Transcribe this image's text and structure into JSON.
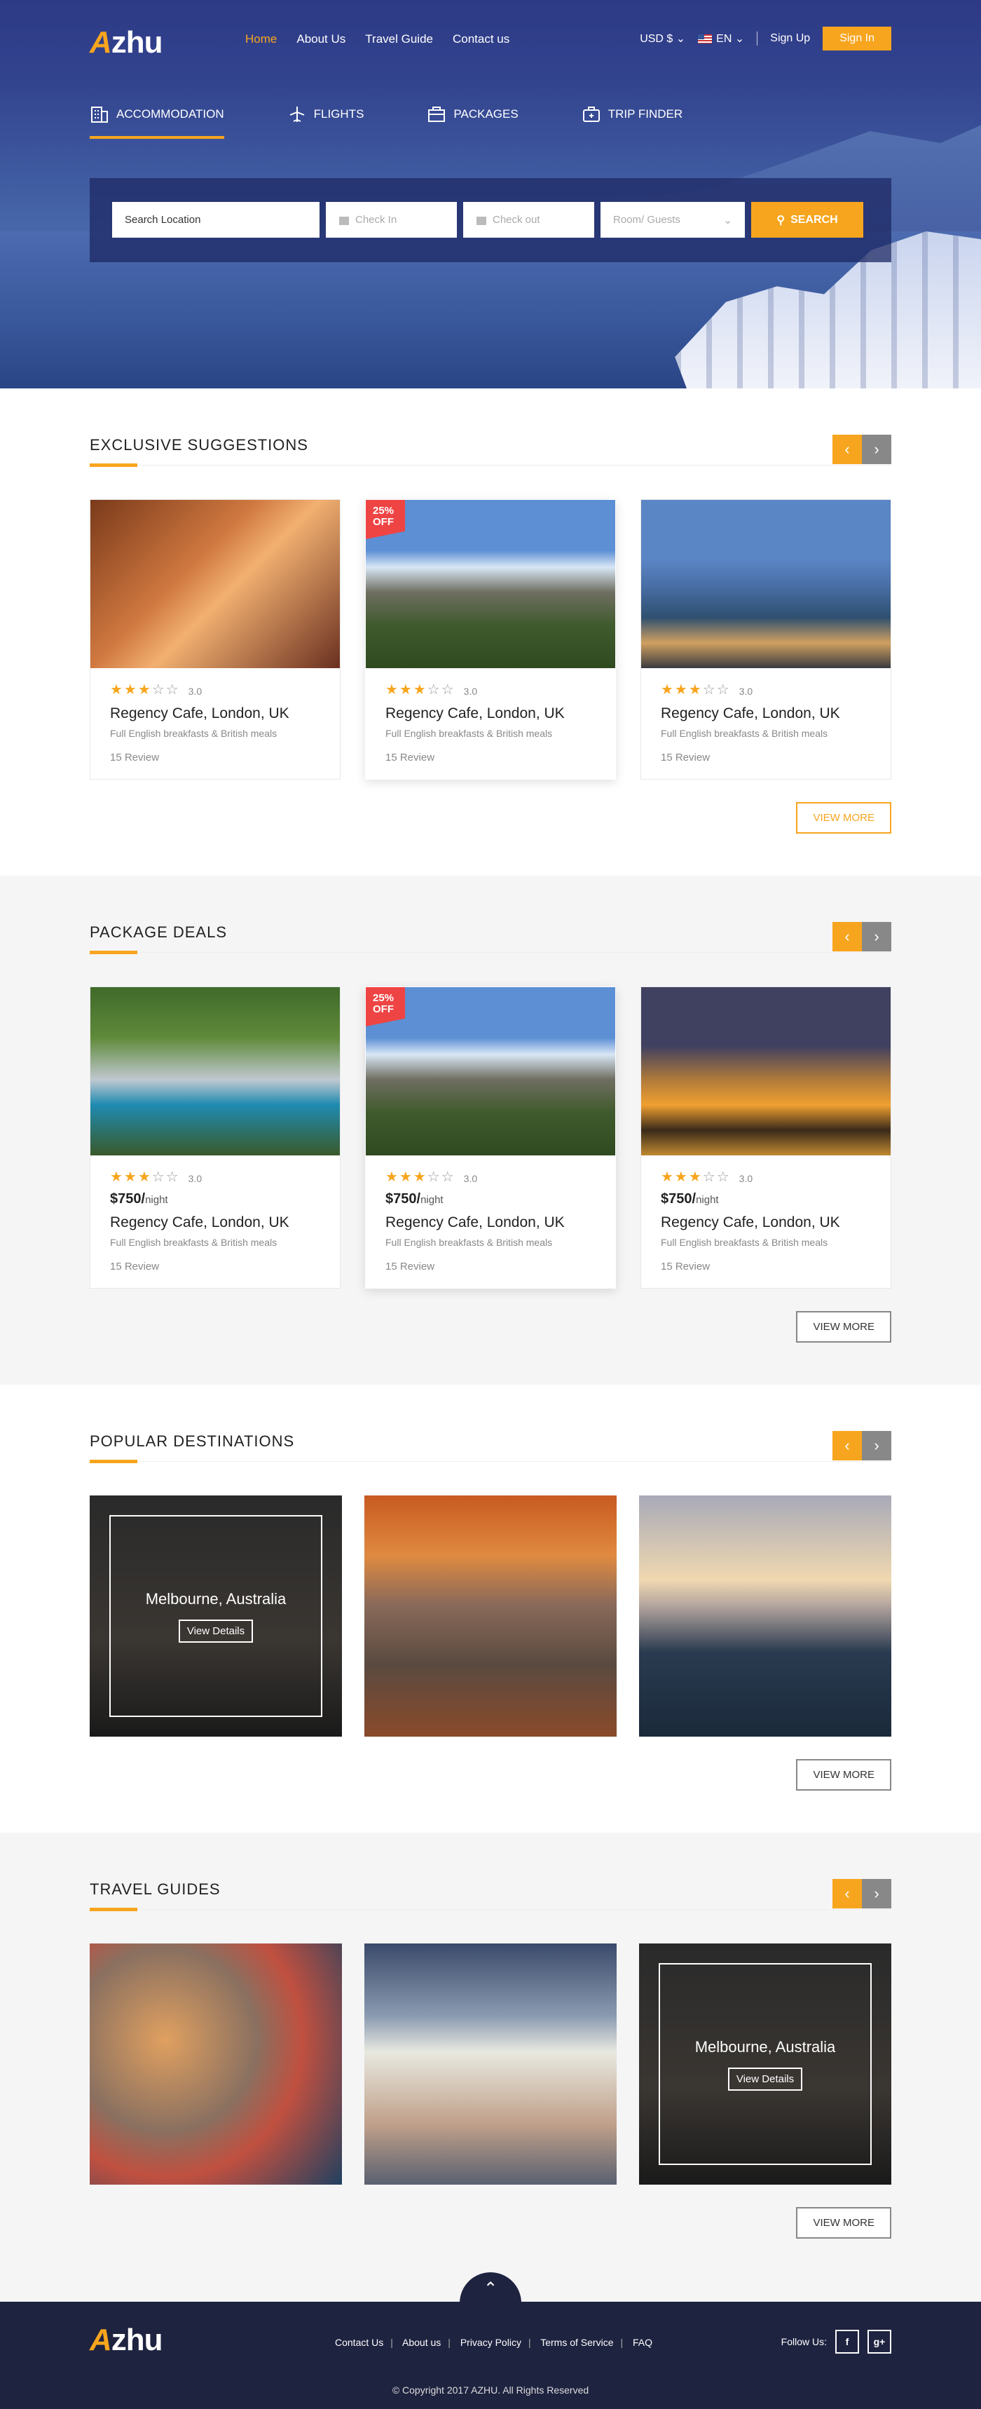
{
  "brand": {
    "logo_a": "A",
    "logo_rest": "zhu"
  },
  "nav": {
    "items": [
      "Home",
      "About Us",
      "Travel Guide",
      "Contact us"
    ],
    "currency": "USD $",
    "language": "EN",
    "signup": "Sign Up",
    "signin": "Sign In"
  },
  "tabs": [
    "ACCOMMODATION",
    "FLIGHTS",
    "PACKAGES",
    "TRIP FINDER"
  ],
  "search": {
    "location_placeholder": "Search Location",
    "checkin": "Check In",
    "checkout": "Check out",
    "guests": "Room/ Guests",
    "button": "SEARCH"
  },
  "exclusive": {
    "title": "EXCLUSIVE SUGGESTIONS",
    "view_more": "VIEW MORE",
    "cards": [
      {
        "badge": "",
        "rating": "3.0",
        "title": "Regency Cafe, London, UK",
        "desc": "Full English breakfasts & British meals",
        "reviews": "15 Review"
      },
      {
        "badge": "25% OFF",
        "rating": "3.0",
        "title": "Regency Cafe, London, UK",
        "desc": "Full English breakfasts & British meals",
        "reviews": "15 Review"
      },
      {
        "badge": "",
        "rating": "3.0",
        "title": "Regency Cafe, London, UK",
        "desc": "Full English breakfasts & British meals",
        "reviews": "15 Review"
      }
    ]
  },
  "packages": {
    "title": "PACKAGE DEALS",
    "view_more": "VIEW MORE",
    "cards": [
      {
        "badge": "",
        "rating": "3.0",
        "price": "$750/",
        "unit": "night",
        "title": "Regency Cafe, London, UK",
        "desc": "Full English breakfasts & British meals",
        "reviews": "15 Review"
      },
      {
        "badge": "25% OFF",
        "rating": "3.0",
        "price": "$750/",
        "unit": "night",
        "title": "Regency Cafe, London, UK",
        "desc": "Full English breakfasts & British meals",
        "reviews": "15 Review"
      },
      {
        "badge": "",
        "rating": "3.0",
        "price": "$750/",
        "unit": "night",
        "title": "Regency Cafe, London, UK",
        "desc": "Full English breakfasts & British meals",
        "reviews": "15 Review"
      }
    ]
  },
  "destinations": {
    "title": "POPULAR DESTINATIONS",
    "view_more": "VIEW MORE",
    "featured": "Melbourne, Australia",
    "details": "View Details"
  },
  "guides": {
    "title": "TRAVEL GUIDES",
    "view_more": "VIEW MORE",
    "featured": "Melbourne, Australia",
    "details": "View Details"
  },
  "footer": {
    "links": [
      "Contact Us",
      "About us",
      "Privacy Policy",
      "Terms of Service",
      "FAQ"
    ],
    "follow": "Follow Us:",
    "facebook": "f",
    "gplus": "g+",
    "copyright": "© Copyright 2017 AZHU. All Rights Reserved"
  },
  "colors": {
    "accent": "#f7a51e",
    "footer": "#1e2340",
    "badge": "#ef4444"
  }
}
